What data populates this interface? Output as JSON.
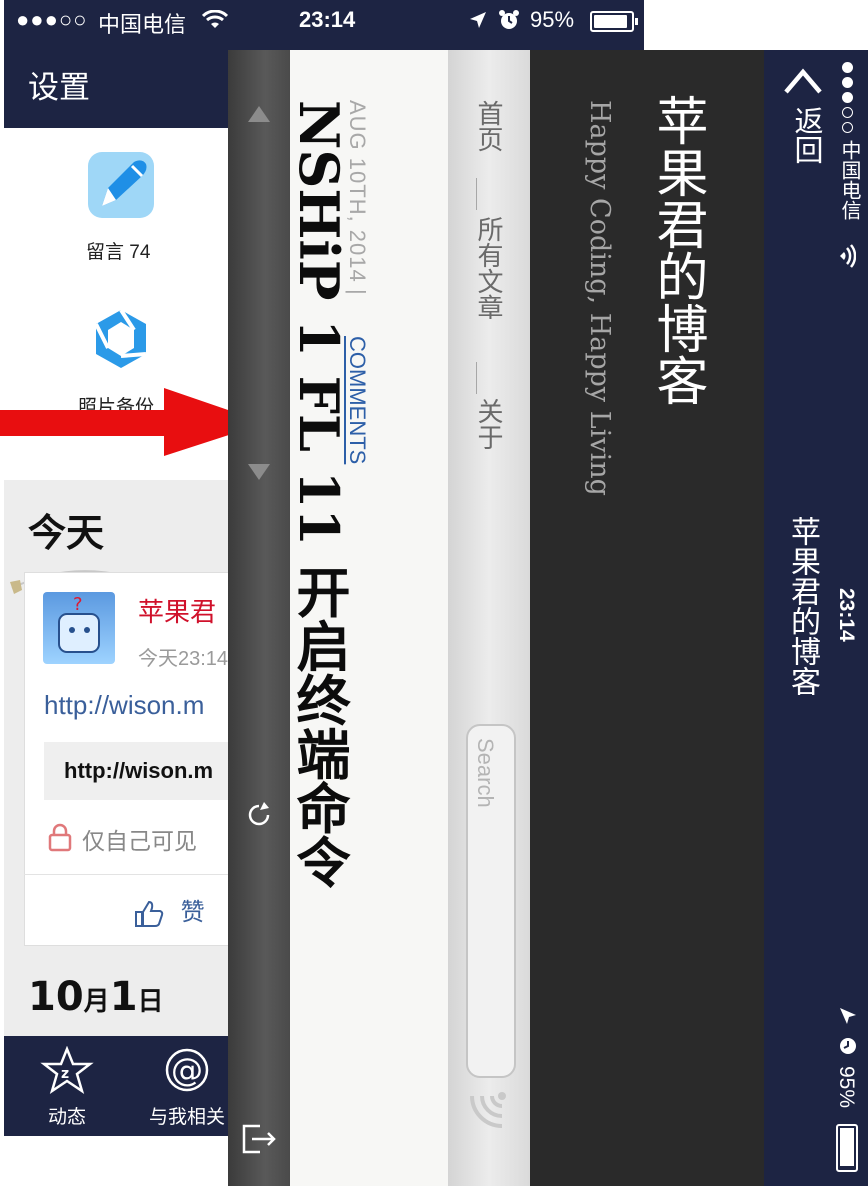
{
  "qq_app": {
    "status_bar": {
      "signal": "●●●○○",
      "carrier": "中国电信",
      "time": "23:14",
      "battery": "95%"
    },
    "nav_title": "设置",
    "apps": [
      {
        "label": "留言 74",
        "icon": "pen-icon",
        "color": "#49a9ef"
      },
      {
        "label": "照片备份",
        "icon": "photo-backup-icon",
        "color": "#2b9ae8"
      }
    ],
    "feed": {
      "section_title": "今天",
      "post": {
        "author": "苹果君",
        "time": "今天23:14",
        "text": "http://wison.m",
        "link_preview": "http://wison.m",
        "privacy": "仅自己可见",
        "like": "赞"
      },
      "next_date": {
        "day_month": "10",
        "month_char": "月",
        "day": "1",
        "day_char": "日"
      }
    },
    "tabbar": [
      {
        "label": "动态",
        "icon": "star-z-icon"
      },
      {
        "label": "与我相关",
        "icon": "at-icon"
      }
    ],
    "accent": "#1d2443"
  },
  "safari_rotated": {
    "status_bar": {
      "carrier": "中国电信",
      "time": "23:14",
      "battery": "95%"
    },
    "nav": {
      "back": "返回",
      "title": "苹果君的博客"
    },
    "blog_header": {
      "title": "苹果君的博客",
      "subtitle": "Happy Coding, Happy Living"
    },
    "menu": [
      "首页",
      "所有文章",
      "关于"
    ],
    "search_placeholder": "Search",
    "article": {
      "date": "AUG 10TH, 2014",
      "separator": "|",
      "comments": "COMMENTS",
      "title_fragment": "NSHiP 1 FL 11 开启终端命令"
    },
    "toolbar_icons": [
      "scroll-up-icon",
      "scroll-down-icon",
      "refresh-icon",
      "exit-icon"
    ]
  }
}
